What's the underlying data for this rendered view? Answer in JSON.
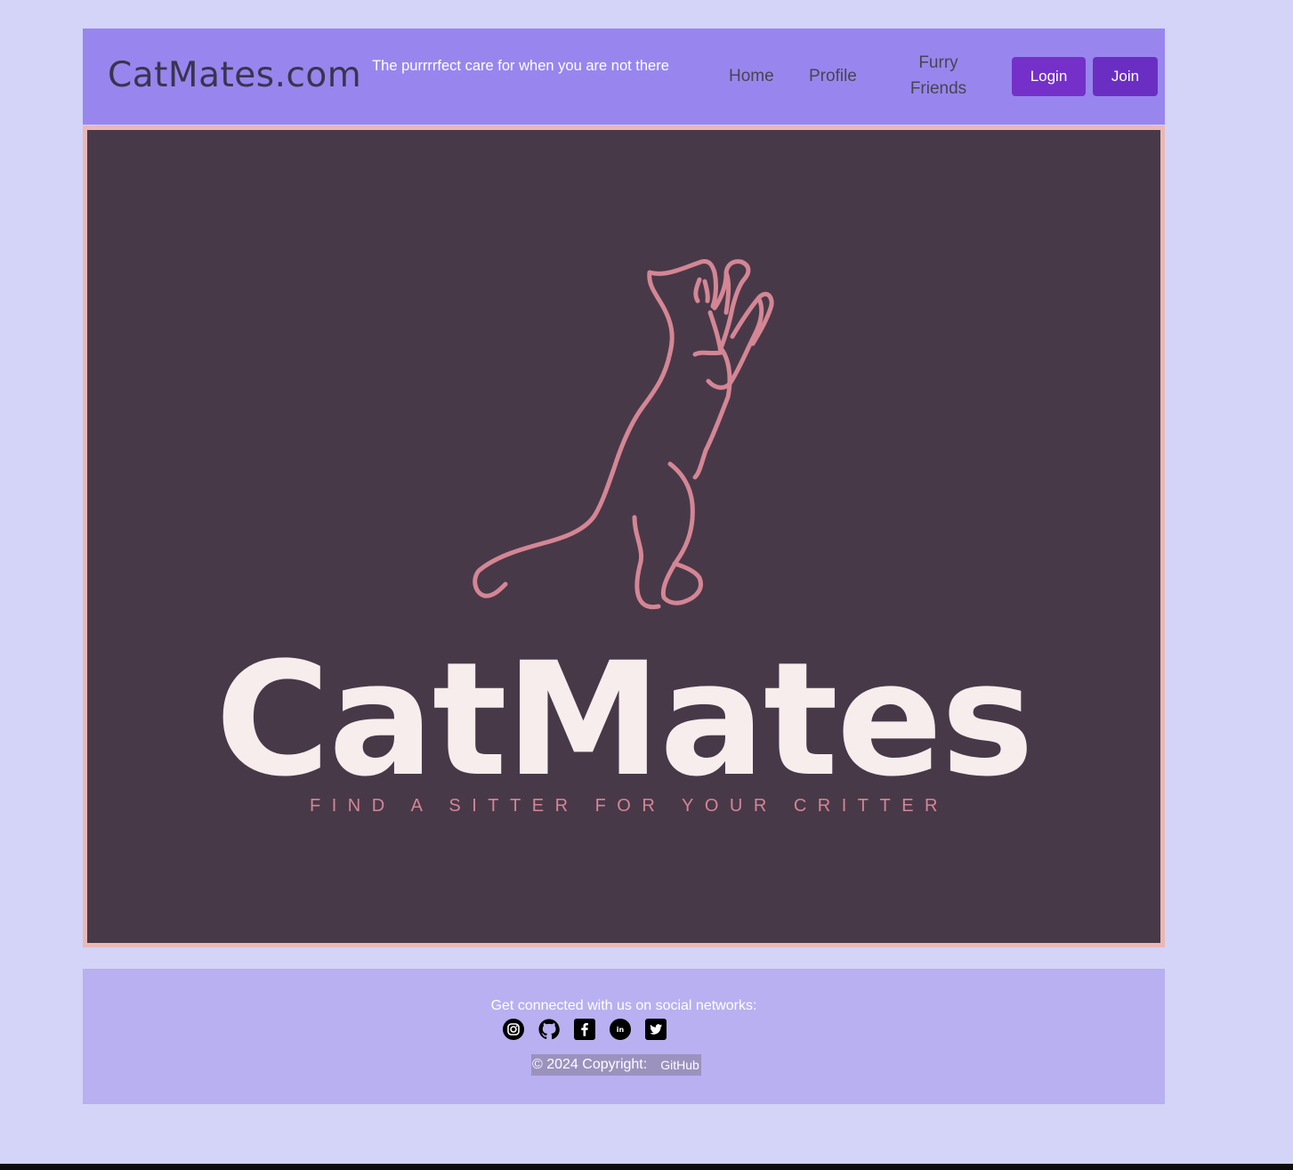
{
  "header": {
    "brand": "CatMates.com",
    "tagline": "The purrrrfect care for when you are not there",
    "nav": {
      "home": "Home",
      "profile": "Profile",
      "furry_friends": "Furry Friends"
    },
    "login_label": "Login",
    "join_label": "Join"
  },
  "hero": {
    "title": "CatMates",
    "subtitle": "FIND A SITTER FOR YOUR CRITTER"
  },
  "footer": {
    "social_text": "Get connected with us on social networks:",
    "social_icons": [
      "instagram-icon",
      "github-icon",
      "facebook-icon",
      "linkedin-icon",
      "twitter-icon"
    ],
    "copyright": "© 2024 Copyright:",
    "copyright_link": "GitHub"
  },
  "colors": {
    "page_bg": "#d3d4f8",
    "navbar_bg": "#9886ee",
    "hero_bg": "#483949",
    "hero_border": "#eab8b6",
    "accent_pink": "#d48694",
    "button_purple": "#7530c9",
    "footer_bg": "#b8b0f0"
  }
}
